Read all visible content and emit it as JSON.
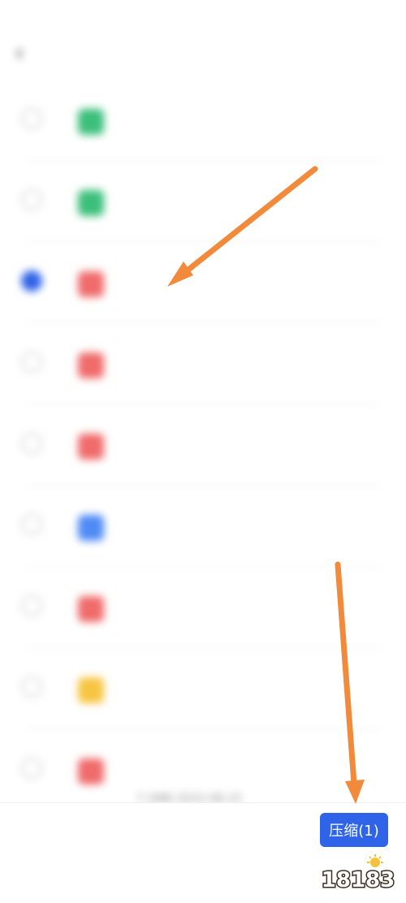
{
  "status_bar": {
    "left_text": "",
    "right_text": ""
  },
  "header": {
    "back_icon": "chevron-left-icon",
    "title": "",
    "action_label": ""
  },
  "files": [
    {
      "name": "",
      "meta": "",
      "icon_color": "#3cbf7a",
      "checked": false
    },
    {
      "name": "",
      "meta": "",
      "icon_color": "#3cbf7a",
      "checked": false
    },
    {
      "name": "",
      "meta": "",
      "icon_color": "#f06b6b",
      "checked": true
    },
    {
      "name": "",
      "meta": "",
      "icon_color": "#f06b6b",
      "checked": false
    },
    {
      "name": "",
      "meta": "",
      "icon_color": "#f06b6b",
      "checked": false
    },
    {
      "name": "",
      "meta": "",
      "icon_color": "#4f8bf4",
      "checked": false
    },
    {
      "name": "",
      "meta": "",
      "icon_color": "#f06b6b",
      "checked": false
    },
    {
      "name": "",
      "meta": "",
      "icon_color": "#f7c542",
      "checked": false
    },
    {
      "name": "",
      "meta": "7.2MB 2022-08-15",
      "icon_color": "#f06b6b",
      "checked": false
    }
  ],
  "bottom_bar": {
    "compress_label": "压缩(1)"
  },
  "colors": {
    "accent": "#2f64e8",
    "arrow": "#f28a3c"
  },
  "watermark": {
    "text": "18183"
  }
}
